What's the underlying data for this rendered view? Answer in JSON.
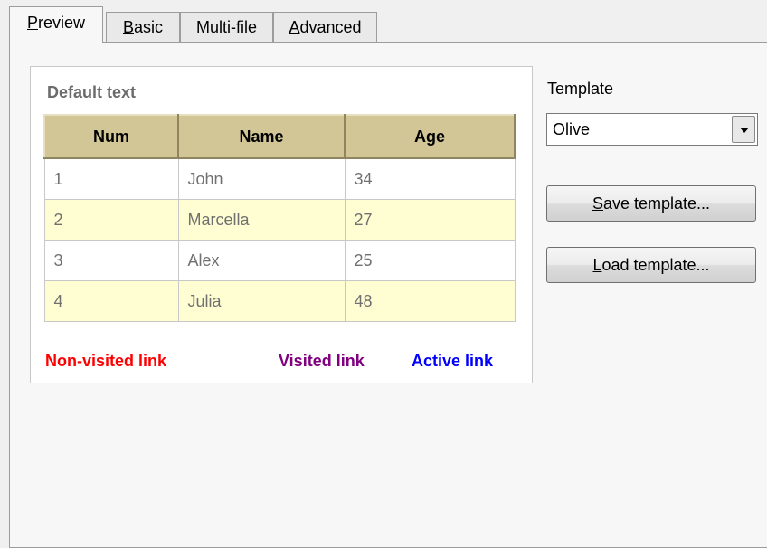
{
  "tabs": [
    {
      "label": "Preview",
      "mnemonic": "P",
      "rest": "review",
      "active": true
    },
    {
      "label": "Basic",
      "mnemonic": "B",
      "rest": "asic",
      "active": false
    },
    {
      "label": "Multi-file",
      "mnemonic": "",
      "rest": "Multi-file",
      "active": false
    },
    {
      "label": "Advanced",
      "mnemonic": "A",
      "rest": "dvanced",
      "active": false
    }
  ],
  "preview": {
    "default_text": "Default text",
    "columns": [
      "Num",
      "Name",
      "Age"
    ],
    "rows": [
      [
        "1",
        "John",
        "34"
      ],
      [
        "2",
        "Marcella",
        "27"
      ],
      [
        "3",
        "Alex",
        "25"
      ],
      [
        "4",
        "Julia",
        "48"
      ]
    ],
    "links": {
      "non_visited": "Non-visited link",
      "visited": "Visited link",
      "active": "Active link"
    },
    "colors": {
      "header_bg": "#d2c697",
      "alt_row_bg": "#fffed2",
      "non_visited": "#ff0000",
      "visited": "#800080",
      "active": "#0000ff",
      "default_text": "#6b6b6b"
    }
  },
  "template": {
    "label": "Template",
    "selected": "Olive",
    "dropdown_icon": "chevron-down-icon"
  },
  "buttons": {
    "save": {
      "mnemonic": "S",
      "rest": "ave template..."
    },
    "load": {
      "mnemonic": "L",
      "rest": "oad template..."
    }
  }
}
